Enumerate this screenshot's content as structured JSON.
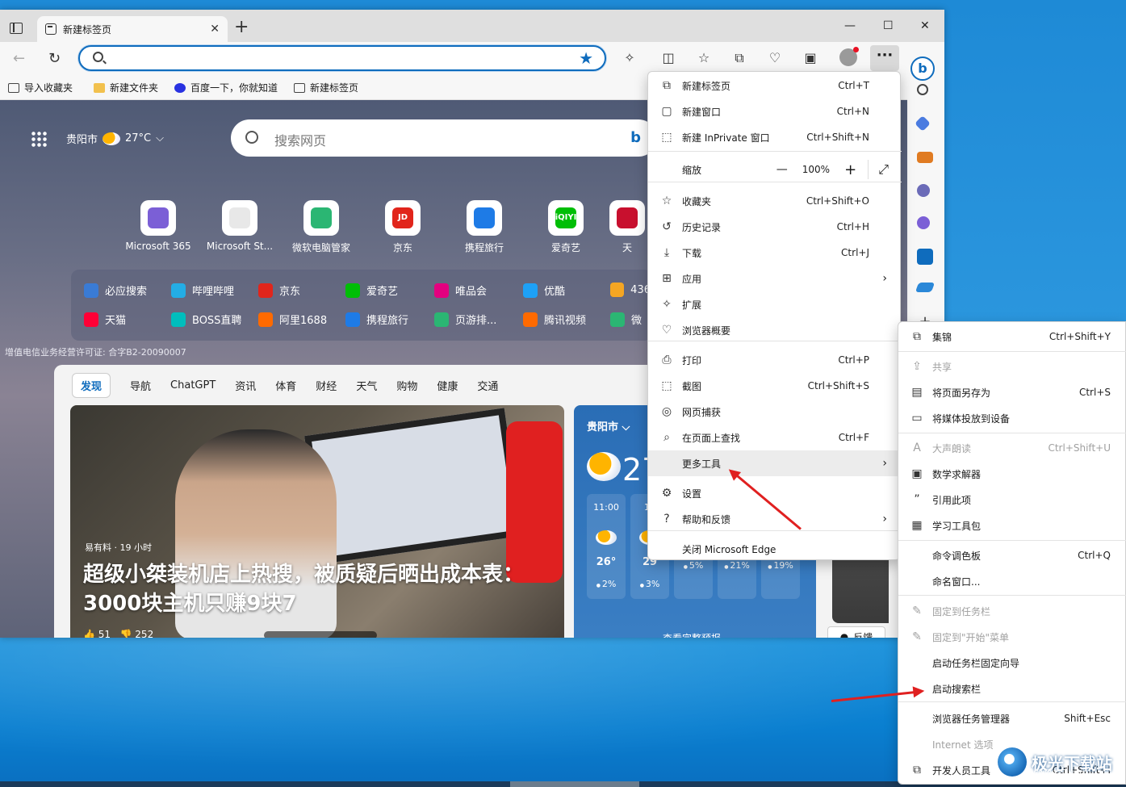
{
  "tab": {
    "title": "新建标签页"
  },
  "address": {
    "value": "",
    "placeholder": ""
  },
  "favorites_bar": [
    {
      "label": "导入收藏夹"
    },
    {
      "label": "新建文件夹"
    },
    {
      "label": "百度一下，你就知道"
    },
    {
      "label": "新建标签页"
    }
  ],
  "newtab": {
    "location": "贵阳市",
    "temp": "27°C",
    "search_placeholder": "搜索网页",
    "tiles": [
      {
        "label": "Microsoft 365",
        "badge": "",
        "color": "#7b5fd6"
      },
      {
        "label": "Microsoft St...",
        "badge": "",
        "color": "#e8e8e8"
      },
      {
        "label": "微软电脑管家",
        "badge": "",
        "color": "#2bb673"
      },
      {
        "label": "京东",
        "badge": "JD",
        "color": "#e1251b"
      },
      {
        "label": "携程旅行",
        "badge": "",
        "color": "#1e7be6"
      },
      {
        "label": "爱奇艺",
        "badge": "iQIYI",
        "color": "#00be06"
      },
      {
        "label": "天",
        "badge": "",
        "color": "#c8102e"
      }
    ],
    "quick_links_row1": [
      {
        "label": "必应搜索",
        "color": "#3a7bd5"
      },
      {
        "label": "哔哩哔哩",
        "color": "#23ade5"
      },
      {
        "label": "京东",
        "color": "#e1251b"
      },
      {
        "label": "爱奇艺",
        "color": "#00be06"
      },
      {
        "label": "唯品会",
        "color": "#e4007f"
      },
      {
        "label": "优酷",
        "color": "#1ea1f7"
      },
      {
        "label": "436",
        "color": "#f5a623"
      }
    ],
    "quick_links_row2": [
      {
        "label": "天猫",
        "color": "#ff0036"
      },
      {
        "label": "BOSS直聘",
        "color": "#00bebd"
      },
      {
        "label": "阿里1688",
        "color": "#ff6a00"
      },
      {
        "label": "携程旅行",
        "color": "#1e7be6"
      },
      {
        "label": "页游排...",
        "color": "#2bb673"
      },
      {
        "label": "腾讯视频",
        "color": "#ff6a00"
      },
      {
        "label": "微",
        "color": "#2bb673"
      }
    ],
    "icp": "增值电信业务经营许可证: 合字B2-20090007",
    "feed_tabs": [
      "发现",
      "导航",
      "ChatGPT",
      "资讯",
      "体育",
      "财经",
      "天气",
      "购物",
      "健康",
      "交通"
    ],
    "news": {
      "source": "易有料 · 19 小时",
      "headline": "超级小桀装机店上热搜，被质疑后晒出成本表：3000块主机只赚9块7",
      "likes": "51",
      "dislikes": "252"
    },
    "weather": {
      "location": "贵阳市",
      "temp_big": "27",
      "hours": [
        {
          "time": "11:00",
          "temp": "26°",
          "precip": "2%"
        },
        {
          "time": "12",
          "temp": "29",
          "precip": "3%"
        },
        {
          "time": "",
          "temp": "",
          "precip": "5%"
        },
        {
          "time": "",
          "temp": "",
          "precip": "21%"
        },
        {
          "time": "",
          "temp": "",
          "precip": "19%"
        }
      ],
      "full_link": "查看完整预报"
    },
    "feedback": "反馈"
  },
  "main_menu": [
    {
      "icon": "new-tab-icon",
      "glyph": "⧉",
      "label": "新建标签页",
      "shortcut": "Ctrl+T"
    },
    {
      "icon": "new-window-icon",
      "glyph": "▢",
      "label": "新建窗口",
      "shortcut": "Ctrl+N"
    },
    {
      "icon": "inprivate-icon",
      "glyph": "⬚",
      "label": "新建 InPrivate 窗口",
      "shortcut": "Ctrl+Shift+N"
    },
    {
      "icon": "",
      "glyph": "",
      "label": "缩放",
      "shortcut": ""
    },
    {
      "icon": "favorites-icon",
      "glyph": "☆",
      "label": "收藏夹",
      "shortcut": "Ctrl+Shift+O"
    },
    {
      "icon": "history-icon",
      "glyph": "↺",
      "label": "历史记录",
      "shortcut": "Ctrl+H"
    },
    {
      "icon": "download-icon",
      "glyph": "⤓",
      "label": "下载",
      "shortcut": "Ctrl+J"
    },
    {
      "icon": "apps-icon",
      "glyph": "⊞",
      "label": "应用",
      "shortcut": ""
    },
    {
      "icon": "extensions-icon",
      "glyph": "✧",
      "label": "扩展",
      "shortcut": ""
    },
    {
      "icon": "browser-essentials-icon",
      "glyph": "♡",
      "label": "浏览器概要",
      "shortcut": ""
    },
    {
      "icon": "print-icon",
      "glyph": "⎙",
      "label": "打印",
      "shortcut": "Ctrl+P"
    },
    {
      "icon": "screenshot-icon",
      "glyph": "⬚",
      "label": "截图",
      "shortcut": "Ctrl+Shift+S"
    },
    {
      "icon": "web-capture-icon",
      "glyph": "◎",
      "label": "网页捕获",
      "shortcut": ""
    },
    {
      "icon": "find-icon",
      "glyph": "⌕",
      "label": "在页面上查找",
      "shortcut": "Ctrl+F"
    },
    {
      "icon": "",
      "glyph": "",
      "label": "更多工具",
      "shortcut": ""
    },
    {
      "icon": "settings-icon",
      "glyph": "⚙",
      "label": "设置",
      "shortcut": ""
    },
    {
      "icon": "help-icon",
      "glyph": "?",
      "label": "帮助和反馈",
      "shortcut": ""
    },
    {
      "icon": "",
      "glyph": "",
      "label": "关闭 Microsoft Edge",
      "shortcut": ""
    }
  ],
  "zoom": {
    "value": "100%",
    "minus": "—",
    "plus": "+",
    "fullscreen": "⤢"
  },
  "sub_menu": [
    {
      "icon": "collections-icon",
      "glyph": "⧉",
      "label": "集锦",
      "shortcut": "Ctrl+Shift+Y"
    },
    {
      "icon": "share-icon",
      "glyph": "⇪",
      "label": "共享",
      "shortcut": ""
    },
    {
      "icon": "save-page-icon",
      "glyph": "▤",
      "label": "将页面另存为",
      "shortcut": "Ctrl+S"
    },
    {
      "icon": "cast-icon",
      "glyph": "▭",
      "label": "将媒体投放到设备",
      "shortcut": ""
    },
    {
      "icon": "read-aloud-icon",
      "glyph": "A",
      "label": "大声朗读",
      "shortcut": "Ctrl+Shift+U"
    },
    {
      "icon": "math-solver-icon",
      "glyph": "▣",
      "label": "数学求解器",
      "shortcut": ""
    },
    {
      "icon": "citation-icon",
      "glyph": "”",
      "label": "引用此项",
      "shortcut": ""
    },
    {
      "icon": "learning-toolkit-icon",
      "glyph": "▦",
      "label": "学习工具包",
      "shortcut": ""
    },
    {
      "icon": "",
      "glyph": "",
      "label": "命令调色板",
      "shortcut": "Ctrl+Q"
    },
    {
      "icon": "",
      "glyph": "",
      "label": "命名窗口...",
      "shortcut": ""
    },
    {
      "icon": "pin-icon",
      "glyph": "✎",
      "label": "固定到任务栏",
      "shortcut": ""
    },
    {
      "icon": "pin-icon",
      "glyph": "✎",
      "label": "固定到\"开始\"菜单",
      "shortcut": ""
    },
    {
      "icon": "",
      "glyph": "",
      "label": "启动任务栏固定向导",
      "shortcut": ""
    },
    {
      "icon": "",
      "glyph": "",
      "label": "启动搜索栏",
      "shortcut": ""
    },
    {
      "icon": "",
      "glyph": "",
      "label": "浏览器任务管理器",
      "shortcut": "Shift+Esc"
    },
    {
      "icon": "",
      "glyph": "",
      "label": "Internet 选项",
      "shortcut": ""
    },
    {
      "icon": "devtools-icon",
      "glyph": "⧉",
      "label": "开发人员工具",
      "shortcut": "Ctrl+Shift+I"
    }
  ],
  "watermark": {
    "text": "极光下载站",
    "sub": "www.xz7.com"
  },
  "colors": {
    "accent": "#0f6cbd",
    "annotation": "#e02020"
  }
}
